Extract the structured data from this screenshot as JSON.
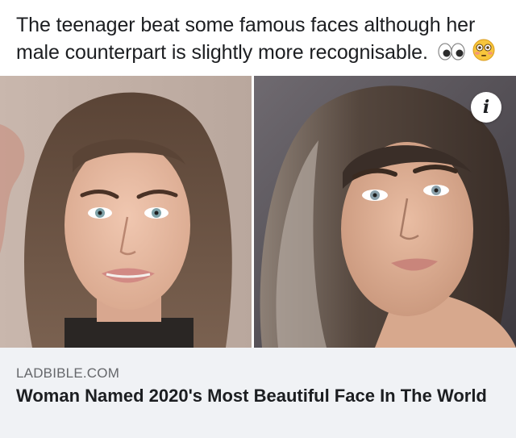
{
  "post": {
    "text": "The teenager beat some famous faces although her male counterpart is slightly more recognisable.",
    "emojis": [
      "eyes-emoji",
      "flushed-face-emoji"
    ]
  },
  "media": {
    "info_badge": "i",
    "photos": [
      {
        "name": "left-portrait",
        "subject": "woman-portrait"
      },
      {
        "name": "right-portrait",
        "subject": "woman-portrait"
      }
    ]
  },
  "link": {
    "domain": "LADBIBLE.COM",
    "title": "Woman Named 2020's Most Beautiful Face In The World"
  },
  "colors": {
    "card_background": "#f0f2f5",
    "text_primary": "#1c1e21",
    "text_secondary": "#65676b"
  }
}
